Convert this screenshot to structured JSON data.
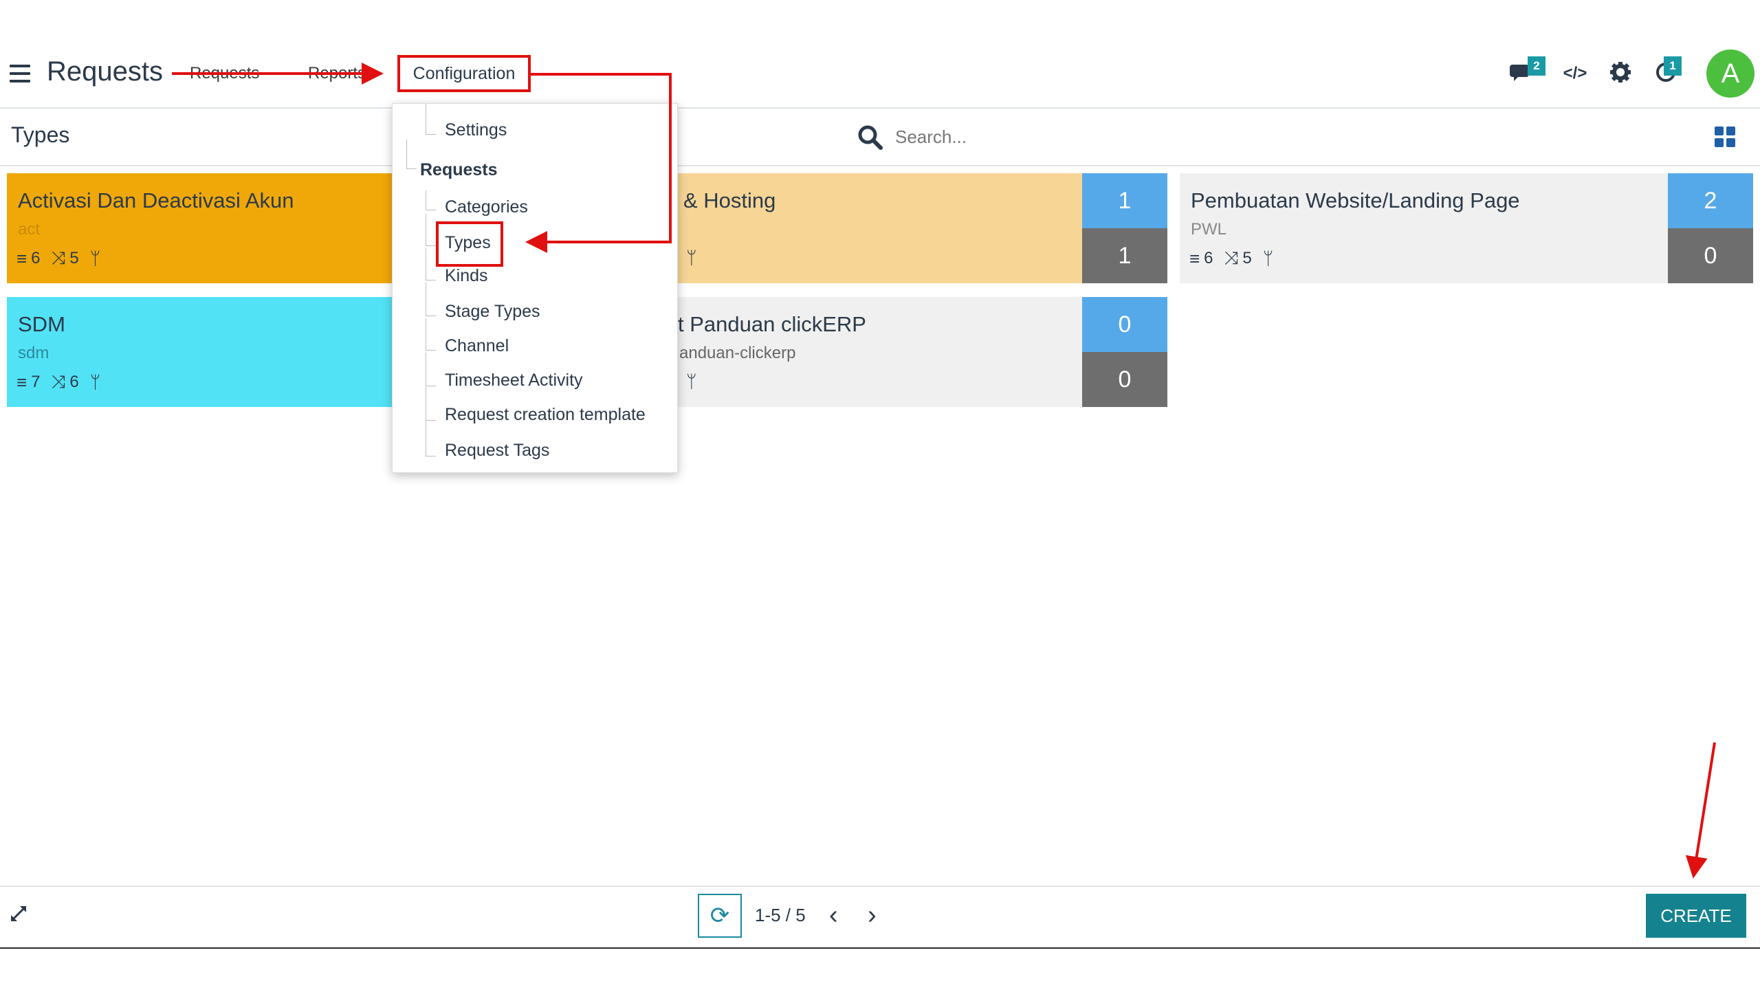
{
  "topnav": {
    "app_title": "Requests",
    "menu": [
      "Requests",
      "Reports",
      "Configuration"
    ],
    "messages_badge": "2",
    "activities_badge": "1",
    "avatar_letter": "A",
    "icons": [
      "hamburger-icon",
      "chat-icon",
      "code-icon",
      "gear-icon",
      "clock-icon"
    ]
  },
  "control_panel": {
    "breadcrumb": "Types",
    "search_placeholder": "Search..."
  },
  "config_menu": {
    "settings": "Settings",
    "section_header": "Requests",
    "items": [
      "Categories",
      "Types",
      "Kinds",
      "Stage Types",
      "Channel",
      "Timesheet Activity",
      "Request creation template",
      "Request Tags"
    ]
  },
  "cards": [
    {
      "title": "Activasi Dan Deactivasi Akun",
      "code": "act",
      "stat1": "6",
      "stat2": "5",
      "color": "#f0a808"
    },
    {
      "title": "& Hosting",
      "count_top": "1",
      "count_bottom": "1",
      "color": "#f7d595"
    },
    {
      "title": "Pembuatan Website/Landing Page",
      "code": "PWL",
      "stat1": "6",
      "stat2": "5",
      "count_top": "2",
      "count_bottom": "0",
      "color": "#f0f0f0"
    },
    {
      "title": "SDM",
      "code": "sdm",
      "stat1": "7",
      "stat2": "6",
      "color": "#52e2f5"
    },
    {
      "title": "t Panduan clickERP",
      "code": "anduan-clickerp",
      "count_top": "0",
      "count_bottom": "0",
      "color": "#f0f0f0"
    }
  ],
  "pager": {
    "value": "1-5 / 5"
  },
  "create_label": "CREATE",
  "colors": {
    "annotation_red": "#e01010",
    "brand_teal": "#14838f",
    "counter_blue": "#56a9e8",
    "counter_gray": "#6e6e6e"
  }
}
